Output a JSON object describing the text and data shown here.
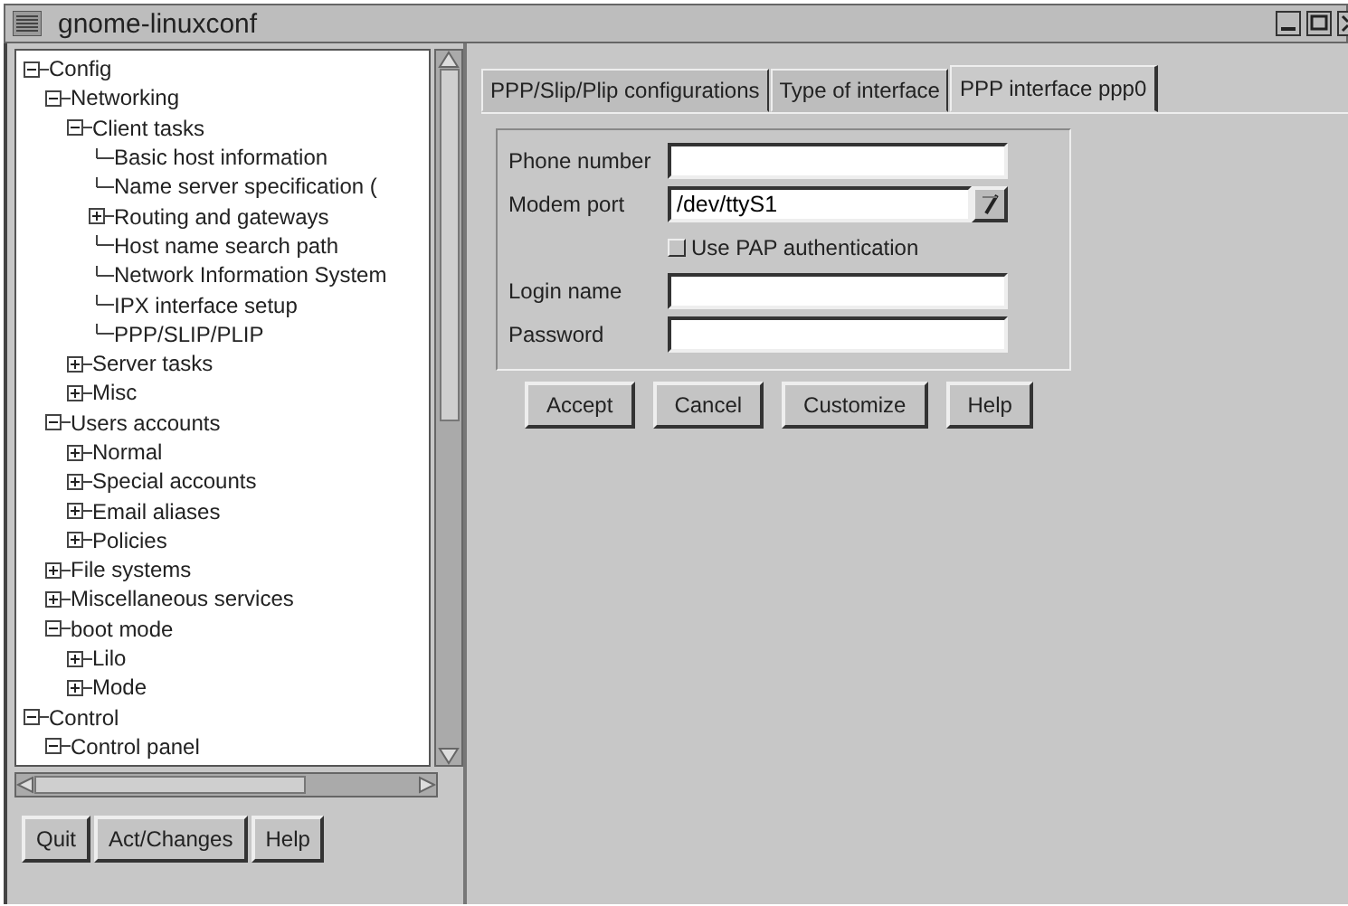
{
  "window": {
    "title": "gnome-linuxconf"
  },
  "tree": [
    {
      "label": "Config",
      "kind": "branch",
      "expanded": true,
      "children": [
        {
          "label": "Networking",
          "kind": "branch",
          "expanded": true,
          "children": [
            {
              "label": "Client tasks",
              "kind": "branch",
              "expanded": true,
              "children": [
                {
                  "label": "Basic host information",
                  "kind": "leaf"
                },
                {
                  "label": "Name server specification (",
                  "kind": "leaf"
                },
                {
                  "label": "Routing and gateways",
                  "kind": "branch",
                  "expanded": false
                },
                {
                  "label": "Host name search path",
                  "kind": "leaf"
                },
                {
                  "label": "Network Information System",
                  "kind": "leaf"
                },
                {
                  "label": "IPX interface setup",
                  "kind": "leaf"
                },
                {
                  "label": "PPP/SLIP/PLIP",
                  "kind": "leaf"
                }
              ]
            },
            {
              "label": "Server tasks",
              "kind": "branch",
              "expanded": false
            },
            {
              "label": "Misc",
              "kind": "branch",
              "expanded": false
            }
          ]
        },
        {
          "label": "Users accounts",
          "kind": "branch",
          "expanded": true,
          "children": [
            {
              "label": "Normal",
              "kind": "branch",
              "expanded": false
            },
            {
              "label": "Special accounts",
              "kind": "branch",
              "expanded": false
            },
            {
              "label": "Email aliases",
              "kind": "branch",
              "expanded": false
            },
            {
              "label": "Policies",
              "kind": "branch",
              "expanded": false
            }
          ]
        },
        {
          "label": "File systems",
          "kind": "branch",
          "expanded": false
        },
        {
          "label": "Miscellaneous services",
          "kind": "branch",
          "expanded": false
        },
        {
          "label": "boot mode",
          "kind": "branch",
          "expanded": true,
          "children": [
            {
              "label": "Lilo",
              "kind": "branch",
              "expanded": false
            },
            {
              "label": "Mode",
              "kind": "branch",
              "expanded": false
            }
          ]
        }
      ]
    },
    {
      "label": "Control",
      "kind": "branch",
      "expanded": true,
      "children": [
        {
          "label": "Control panel",
          "kind": "branch",
          "expanded": true
        }
      ]
    }
  ],
  "left_buttons": [
    "Quit",
    "Act/Changes",
    "Help"
  ],
  "tabs": [
    {
      "label": "PPP/Slip/Plip configurations",
      "selected": false
    },
    {
      "label": "Type of interface",
      "selected": false
    },
    {
      "label": "PPP interface ppp0",
      "selected": true
    }
  ],
  "form": {
    "fields": [
      {
        "label": "Phone number",
        "kind": "text"
      },
      {
        "label": "Modem port",
        "kind": "combo",
        "value": "/dev/ttyS1"
      },
      {
        "label": "Use PAP authentication",
        "kind": "checkbox",
        "checked": false
      },
      {
        "label": "Login name",
        "kind": "text"
      },
      {
        "label": "Password",
        "kind": "text"
      }
    ]
  },
  "buttons": [
    "Accept",
    "Cancel",
    "Customize",
    "Help"
  ]
}
